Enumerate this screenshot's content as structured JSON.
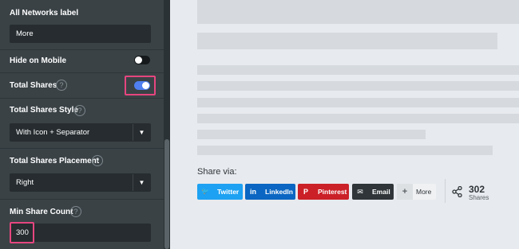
{
  "settings": {
    "all_networks_label": {
      "label": "All Networks label",
      "value": "More"
    },
    "hide_on_mobile": {
      "label": "Hide on Mobile",
      "enabled": false
    },
    "total_shares": {
      "label": "Total Shares",
      "enabled": true
    },
    "total_shares_style": {
      "label": "Total Shares Style",
      "value": "With Icon + Separator"
    },
    "total_shares_placement": {
      "label": "Total Shares Placement",
      "value": "Right"
    },
    "min_share_count": {
      "label": "Min Share Count",
      "value": "300"
    },
    "help_glyph": "?",
    "dropdown_glyph": "▼"
  },
  "preview": {
    "share_via": "Share via:",
    "buttons": [
      {
        "label": "Twitter",
        "icon": "twitter-icon",
        "glyph": "🐦",
        "color": "#1da1f2"
      },
      {
        "label": "LinkedIn",
        "icon": "linkedin-icon",
        "glyph": "in",
        "color": "#0a66c2"
      },
      {
        "label": "Pinterest",
        "icon": "pinterest-icon",
        "glyph": "P",
        "color": "#cb2027"
      },
      {
        "label": "Email",
        "icon": "email-icon",
        "glyph": "✉",
        "color": "#2f3538"
      },
      {
        "label": "More",
        "icon": "plus-icon",
        "glyph": "+",
        "color": "#e9ebed"
      }
    ],
    "share_count": "302",
    "share_count_label": "Shares"
  },
  "colors": {
    "accent_toggle_on": "#4f7ff0",
    "highlight": "#e6467f",
    "panel_bg": "#3a4246",
    "preview_bg": "#e7eaee"
  }
}
